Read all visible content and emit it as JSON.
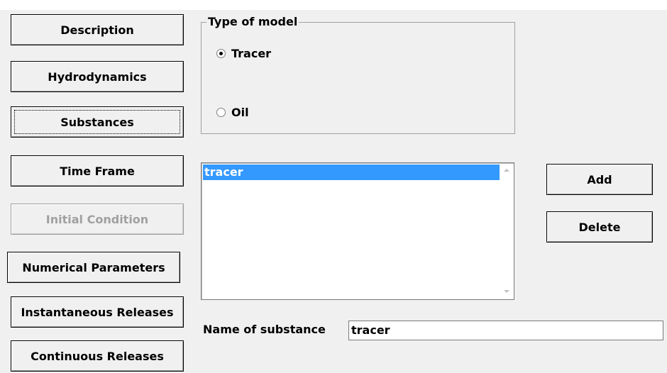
{
  "nav": {
    "description": "Description",
    "hydrodynamics": "Hydrodynamics",
    "substances": "Substances",
    "time_frame": "Time Frame",
    "initial_condition": "Initial Condition",
    "numerical_parameters": "Numerical Parameters",
    "instantaneous_releases": "Instantaneous Releases",
    "continuous_releases": "Continuous Releases"
  },
  "model_type": {
    "title": "Type of model",
    "options": [
      "Tracer",
      "Oil"
    ],
    "selected": "Tracer"
  },
  "substances": {
    "items": [
      "tracer"
    ],
    "selected": "tracer"
  },
  "actions": {
    "add": "Add",
    "delete": "Delete"
  },
  "name_field": {
    "label": "Name of substance",
    "value": "tracer"
  }
}
